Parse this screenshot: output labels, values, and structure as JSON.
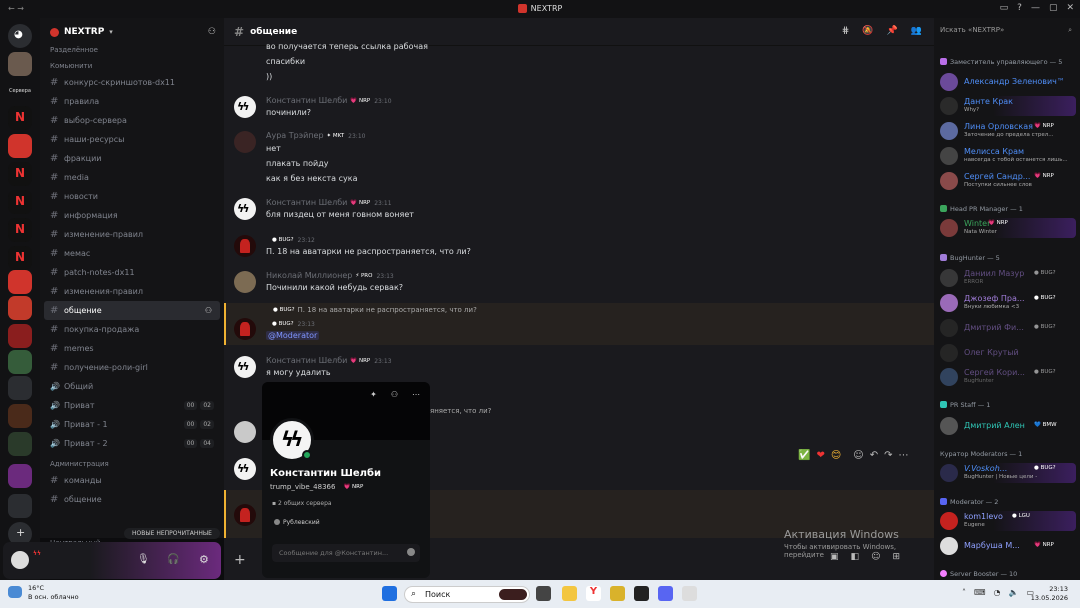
{
  "window": {
    "title": "NEXTRP"
  },
  "server": {
    "name": "NEXTRP",
    "unsorted": "Разделённое"
  },
  "rail": {
    "servers_label": "Сервера"
  },
  "sidebar": {
    "cat_main": "Комьюнити",
    "channels": [
      {
        "icon": "#",
        "label": "конкурс-скриншотов-dx11"
      },
      {
        "icon": "#",
        "label": "правила"
      },
      {
        "icon": "#",
        "label": "выбор-сервера"
      },
      {
        "icon": "#",
        "label": "наши-ресурсы"
      },
      {
        "icon": "#",
        "label": "фракции"
      },
      {
        "icon": "#",
        "label": "media"
      },
      {
        "icon": "#",
        "label": "новости"
      },
      {
        "icon": "#",
        "label": "информация"
      },
      {
        "icon": "#",
        "label": "изменение-правил"
      },
      {
        "icon": "#",
        "label": "мемас"
      },
      {
        "icon": "#",
        "label": "patch-notes-dx11"
      },
      {
        "icon": "#",
        "label": "изменения-правил"
      },
      {
        "icon": "#",
        "label": "общение"
      },
      {
        "icon": "#",
        "label": "покупка-продажа"
      },
      {
        "icon": "#",
        "label": "memes"
      },
      {
        "icon": "#",
        "label": "получение-роли-girl"
      },
      {
        "icon": "🔊",
        "label": "Общий"
      },
      {
        "icon": "🔊",
        "label": "Приват",
        "c1": "00",
        "c2": "02"
      },
      {
        "icon": "🔊",
        "label": "Приват - 1",
        "c1": "00",
        "c2": "02"
      },
      {
        "icon": "🔊",
        "label": "Приват - 2",
        "c1": "00",
        "c2": "04"
      }
    ],
    "cat_admin": "Администрация",
    "admin_channels": [
      {
        "label": "команды"
      },
      {
        "label": "общение"
      }
    ],
    "cat_central": "Центральный",
    "unread": "НОВЫЕ НЕПРОЧИТАННЫЕ"
  },
  "chat": {
    "channel": "общение",
    "lines": {
      "top1": "во получается теперь ссылка рабочая",
      "top2": "спасибки",
      "top3": "))"
    },
    "messages": [
      {
        "author": "Константин Шелби",
        "badge": "NRP",
        "time": "23:10",
        "text": "починили?"
      },
      {
        "author": "Аура Трэйпер",
        "badge": "MKT",
        "time": "23:10",
        "text1": "нет",
        "text2": "плакать пойду",
        "text3": "как я без некста сука"
      },
      {
        "author": "Константин Шелби",
        "badge": "NRP",
        "time": "23:11",
        "text": "бля пиздец от меня говном воняет"
      },
      {
        "author": "",
        "badge": "BUG?",
        "time": "23:12",
        "text": "П. 18 на аватарки не распространяется, что ли?"
      },
      {
        "author": "Николай Миллионер",
        "badge": "PRO",
        "time": "23:13",
        "text": "Починили какой небудь сервак?"
      },
      {
        "reply": "П. 18 на аватарки не распространяется, что ли?",
        "reply_badge": "BUG?",
        "badge": "BUG?",
        "time": "23:13",
        "mention": "@Moderator"
      },
      {
        "author": "Константин Шелби",
        "badge": "NRP",
        "time": "23:13",
        "text": "я могу удалить"
      },
      {
        "fragment": "яняется, что ли?"
      }
    ],
    "reactions": [
      "✅",
      "❤",
      "😊"
    ]
  },
  "profile": {
    "name": "Константин Шелби",
    "username": "trump_vibe_48366",
    "badge": "NRP",
    "mutual": "2 общих сервера",
    "role": "Рублевский",
    "placeholder": "Сообщение для @Константин..."
  },
  "watermark": {
    "line1": "Активация Windows",
    "line2": "Чтобы активировать Windows, перейдите"
  },
  "members": {
    "search": "Искать «NEXTRP»",
    "groups": [
      {
        "title": "Заместитель управляющего — 5",
        "color": "#b96ee8"
      },
      {
        "title": "Head PR Manager — 1",
        "color": "#3ba55c"
      },
      {
        "title": "BugHunter — 5",
        "color": "#a07cd8"
      },
      {
        "title": "PR Staff — 1",
        "color": "#2fc5b5"
      },
      {
        "title": "Куратор Moderators — 1",
        "color": "#aaaaaa"
      },
      {
        "title": "Moderator — 2",
        "color": "#5865f2"
      },
      {
        "title": "Server Booster — 10",
        "color": "#f47fff"
      }
    ],
    "list": [
      {
        "name": "Александр Зеленович™",
        "status": "",
        "badge": "",
        "color": "#4f8ef7"
      },
      {
        "name": "Данте Крак",
        "status": "Why?",
        "badge": "",
        "color": "#4f8ef7"
      },
      {
        "name": "Лина Орловская",
        "status": "Заточение до предела стрел...",
        "badge": "NRP",
        "color": "#4f8ef7"
      },
      {
        "name": "Мелисса Крам",
        "status": "навсегда с тобой останется лишь...",
        "badge": "",
        "color": "#4f8ef7"
      },
      {
        "name": "Сергей Сандр...",
        "status": "Поступки сильнее слов",
        "badge": "NRP",
        "color": "#4f8ef7"
      },
      {
        "name": "Winter",
        "status": "Nata Winter",
        "badge": "NRP",
        "color": "#3ba55c"
      },
      {
        "name": "Даниил Мазур",
        "status": "ERROR",
        "badge": "BUG?",
        "color": "#a07cd8"
      },
      {
        "name": "Джозеф Пра...",
        "status": "Внуки любимка <3",
        "badge": "BUG?",
        "color": "#a07cd8"
      },
      {
        "name": "Дмитрий Фи...",
        "status": "",
        "badge": "BUG?",
        "color": "#a07cd8"
      },
      {
        "name": "Олег Крутый",
        "status": "",
        "badge": "",
        "color": "#a07cd8"
      },
      {
        "name": "Сергей Кори...",
        "status": "BugHunter",
        "badge": "BUG?",
        "color": "#a07cd8"
      },
      {
        "name": "Дмитрий Ален",
        "status": "",
        "badge": "BMW",
        "color": "#2fc5b5"
      },
      {
        "name": "V.Voskoh...",
        "status": "BugHunter | Новые цели -",
        "badge": "BUG?",
        "color": "#4f8ef7"
      },
      {
        "name": "kom1levo",
        "status": "Eugene",
        "badge": "LGU",
        "color": "#5865f2"
      },
      {
        "name": "Марбуша М...",
        "status": "",
        "badge": "NRP",
        "color": "#5865f2"
      }
    ]
  },
  "taskbar": {
    "temp": "16°C",
    "weather": "В осн. облачно",
    "search": "Поиск",
    "time": "23:13",
    "date": "13.05.2026"
  }
}
